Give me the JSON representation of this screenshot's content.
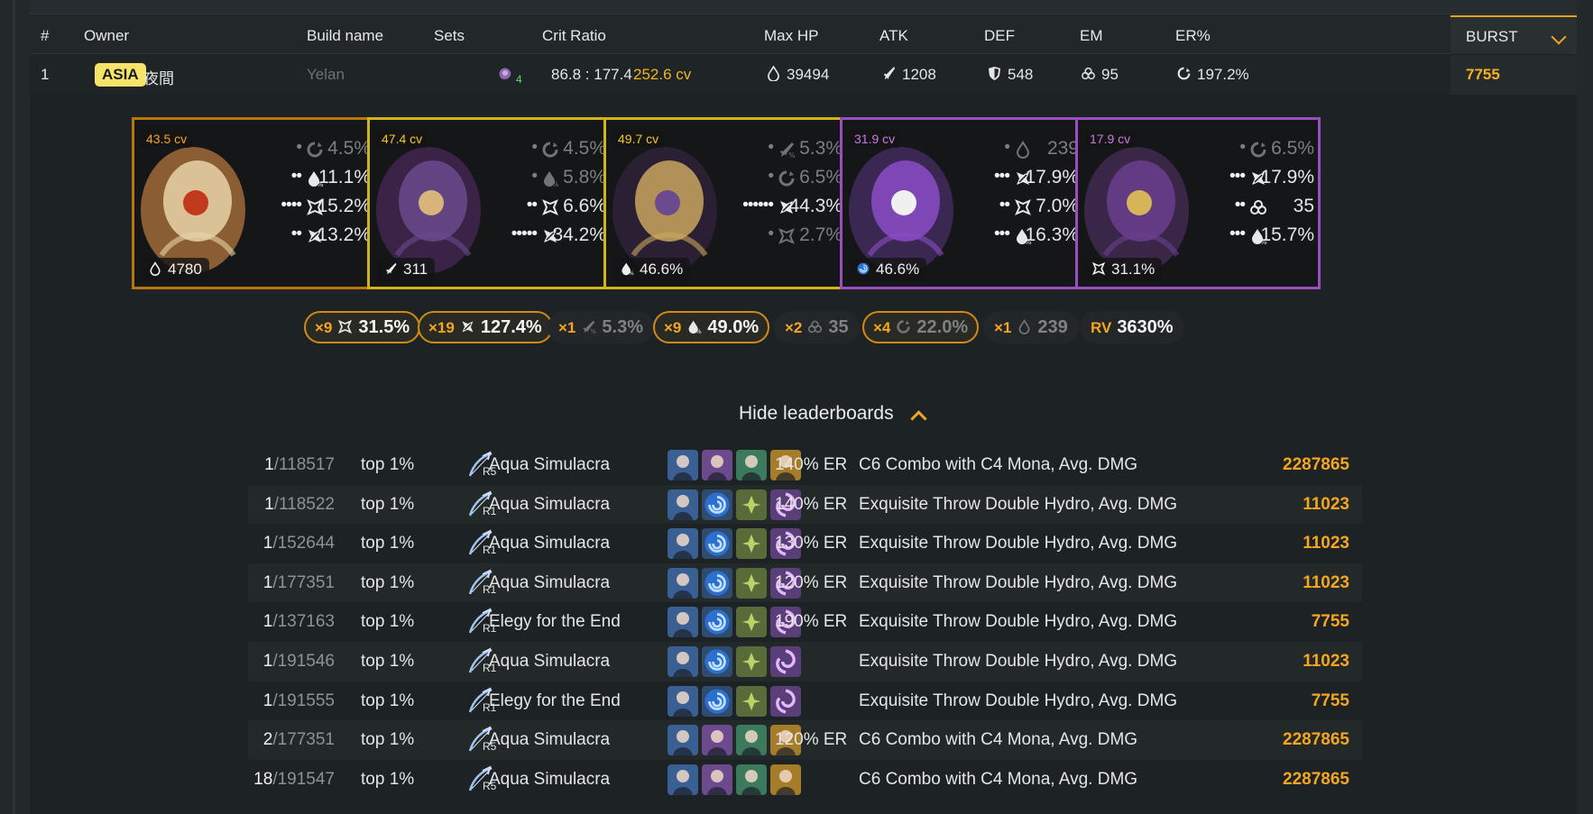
{
  "colors": {
    "accent": "#f5a620",
    "badge": "#f5e36a",
    "legendary_border": "#b8760d",
    "epic_border": "#9b4ec0",
    "gold_border": "#cfb51a"
  },
  "table": {
    "headers": [
      "#",
      "Owner",
      "Build name",
      "Sets",
      "Crit Ratio",
      "Max HP",
      "ATK",
      "DEF",
      "EM",
      "ER%",
      "BURST"
    ],
    "row": {
      "index": "1",
      "region": "ASIA",
      "owner": "夜間",
      "build_name": "Yelan",
      "set_count": "4",
      "crit_ratio": "86.8 : 177.4",
      "cv": "252.6 cv",
      "max_hp": "39494",
      "atk": "1208",
      "def": "548",
      "em": "95",
      "er": "197.2%",
      "burst": "7755"
    }
  },
  "artifacts": [
    {
      "cv": "43.5 cv",
      "main_icon": "hp-drop-icon",
      "main": "4780",
      "subs": [
        {
          "dots": "•",
          "icon": "er-icon",
          "value": "4.5%",
          "dim": true
        },
        {
          "dots": "••",
          "icon": "hp-pct-icon",
          "value": "11.1%",
          "dim": false
        },
        {
          "dots": "••••",
          "icon": "crit-rate-icon",
          "value": "15.2%",
          "dim": false
        },
        {
          "dots": "••",
          "icon": "crit-dmg-icon",
          "value": "13.2%",
          "dim": false
        }
      ]
    },
    {
      "cv": "47.4 cv",
      "main_icon": "atk-sword-icon",
      "main": "311",
      "subs": [
        {
          "dots": "•",
          "icon": "er-icon",
          "value": "4.5%",
          "dim": true
        },
        {
          "dots": "•",
          "icon": "hp-pct-icon",
          "value": "5.8%",
          "dim": true
        },
        {
          "dots": "••",
          "icon": "crit-rate-icon",
          "value": "6.6%",
          "dim": false
        },
        {
          "dots": "•••••",
          "icon": "crit-dmg-icon",
          "value": "34.2%",
          "dim": false
        }
      ]
    },
    {
      "cv": "49.7 cv",
      "main_icon": "hp-pct-icon",
      "main": "46.6%",
      "subs": [
        {
          "dots": "•",
          "icon": "atk-pct-icon",
          "value": "5.3%",
          "dim": true
        },
        {
          "dots": "•",
          "icon": "er-icon",
          "value": "6.5%",
          "dim": true
        },
        {
          "dots": "••••••",
          "icon": "crit-dmg-icon",
          "value": "44.3%",
          "dim": false
        },
        {
          "dots": "•",
          "icon": "crit-rate-icon",
          "value": "2.7%",
          "dim": true
        }
      ]
    },
    {
      "cv": "31.9 cv",
      "main_icon": "hydro-icon",
      "main": "46.6%",
      "subs": [
        {
          "dots": "•",
          "icon": "hp-drop-icon",
          "value": "239",
          "dim": true
        },
        {
          "dots": "•••",
          "icon": "crit-dmg-icon",
          "value": "17.9%",
          "dim": false
        },
        {
          "dots": "••",
          "icon": "crit-rate-icon",
          "value": "7.0%",
          "dim": false
        },
        {
          "dots": "•••",
          "icon": "hp-pct-icon",
          "value": "16.3%",
          "dim": false
        }
      ]
    },
    {
      "cv": "17.9 cv",
      "main_icon": "crit-rate-icon",
      "main": "31.1%",
      "subs": [
        {
          "dots": "•",
          "icon": "er-icon",
          "value": "6.5%",
          "dim": true
        },
        {
          "dots": "•••",
          "icon": "crit-dmg-icon",
          "value": "17.9%",
          "dim": false
        },
        {
          "dots": "••",
          "icon": "em-icon",
          "value": "35",
          "dim": false
        },
        {
          "dots": "•••",
          "icon": "hp-pct-icon",
          "value": "15.7%",
          "dim": false
        }
      ]
    }
  ],
  "summary_chips": [
    {
      "mult": "×9",
      "icon": "crit-rate-icon",
      "value": "31.5%",
      "highlight": true,
      "dim": false
    },
    {
      "mult": "×19",
      "icon": "crit-dmg-icon",
      "value": "127.4%",
      "highlight": true,
      "dim": false
    },
    {
      "mult": "×1",
      "icon": "atk-pct-icon",
      "value": "5.3%",
      "highlight": false,
      "dim": true
    },
    {
      "mult": "×9",
      "icon": "hp-pct-icon",
      "value": "49.0%",
      "highlight": true,
      "dim": false
    },
    {
      "mult": "×2",
      "icon": "em-icon",
      "value": "35",
      "highlight": false,
      "dim": true
    },
    {
      "mult": "×4",
      "icon": "er-icon",
      "value": "22.0%",
      "highlight": true,
      "dim": true
    },
    {
      "mult": "×1",
      "icon": "hp-drop-icon",
      "value": "239",
      "highlight": false,
      "dim": true
    },
    {
      "mult": "RV",
      "icon": "",
      "value": "3630%",
      "highlight": false,
      "dim": false
    }
  ],
  "hide_leaderboards": "Hide leaderboards",
  "leaderboard": [
    {
      "rank": "1",
      "total": "/118517",
      "pct": "top 1%",
      "refine": "R5",
      "weapon": "Aqua Simulacra",
      "team": [
        "blue",
        "purple",
        "green",
        "gold"
      ],
      "er": "140% ER",
      "calc": "C6 Combo with C4 Mona, Avg. DMG",
      "score": "2287865"
    },
    {
      "rank": "1",
      "total": "/118522",
      "pct": "top 1%",
      "refine": "R1",
      "weapon": "Aqua Simulacra",
      "team": [
        "blue",
        "hydro",
        "dendro",
        "electro"
      ],
      "er": "140% ER",
      "calc": "Exquisite Throw Double Hydro, Avg. DMG",
      "score": "11023"
    },
    {
      "rank": "1",
      "total": "/152644",
      "pct": "top 1%",
      "refine": "R1",
      "weapon": "Aqua Simulacra",
      "team": [
        "blue",
        "hydro",
        "dendro",
        "electro"
      ],
      "er": "130% ER",
      "calc": "Exquisite Throw Double Hydro, Avg. DMG",
      "score": "11023"
    },
    {
      "rank": "1",
      "total": "/177351",
      "pct": "top 1%",
      "refine": "R1",
      "weapon": "Aqua Simulacra",
      "team": [
        "blue",
        "hydro",
        "dendro",
        "electro"
      ],
      "er": "120% ER",
      "calc": "Exquisite Throw Double Hydro, Avg. DMG",
      "score": "11023"
    },
    {
      "rank": "1",
      "total": "/137163",
      "pct": "top 1%",
      "refine": "R1",
      "weapon": "Elegy for the End",
      "team": [
        "blue",
        "hydro",
        "dendro",
        "electro"
      ],
      "er": "190% ER",
      "calc": "Exquisite Throw Double Hydro, Avg. DMG",
      "score": "7755"
    },
    {
      "rank": "1",
      "total": "/191546",
      "pct": "top 1%",
      "refine": "R1",
      "weapon": "Aqua Simulacra",
      "team": [
        "blue",
        "hydro",
        "dendro",
        "electro"
      ],
      "er": "",
      "calc": "Exquisite Throw Double Hydro, Avg. DMG",
      "score": "11023"
    },
    {
      "rank": "1",
      "total": "/191555",
      "pct": "top 1%",
      "refine": "R1",
      "weapon": "Elegy for the End",
      "team": [
        "blue",
        "hydro",
        "dendro",
        "electro"
      ],
      "er": "",
      "calc": "Exquisite Throw Double Hydro, Avg. DMG",
      "score": "7755"
    },
    {
      "rank": "2",
      "total": "/177351",
      "pct": "top 1%",
      "refine": "R5",
      "weapon": "Aqua Simulacra",
      "team": [
        "blue",
        "purple",
        "green",
        "gold"
      ],
      "er": "120% ER",
      "calc": "C6 Combo with C4 Mona, Avg. DMG",
      "score": "2287865"
    },
    {
      "rank": "18",
      "total": "/191547",
      "pct": "top 1%",
      "refine": "R5",
      "weapon": "Aqua Simulacra",
      "team": [
        "blue",
        "purple",
        "green",
        "gold"
      ],
      "er": "",
      "calc": "C6 Combo with C4 Mona, Avg. DMG",
      "score": "2287865"
    }
  ]
}
